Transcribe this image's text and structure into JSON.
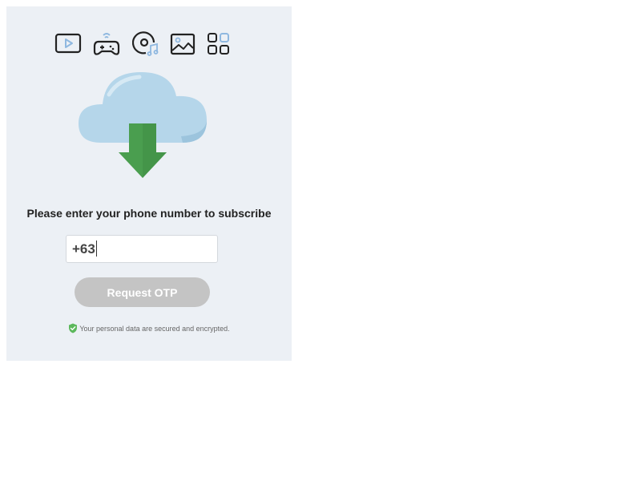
{
  "icons": [
    "video-icon",
    "gamepad-icon",
    "music-disc-icon",
    "image-icon",
    "apps-grid-icon"
  ],
  "illustration": "cloud-download-icon",
  "form": {
    "prompt": "Please enter your phone number to subscribe",
    "phone_value": "+63",
    "button_label": "Request OTP",
    "button_color": "#c4c4c4"
  },
  "footer": {
    "security_note": "Your personal data are secured and encrypted.",
    "shield_color": "#5cb85c"
  },
  "colors": {
    "panel_bg": "#ecf0f5",
    "icon_stroke": "#222222",
    "icon_accent": "#8fb8e0",
    "cloud": "#b5d6ea",
    "arrow": "#4a9e4f"
  }
}
